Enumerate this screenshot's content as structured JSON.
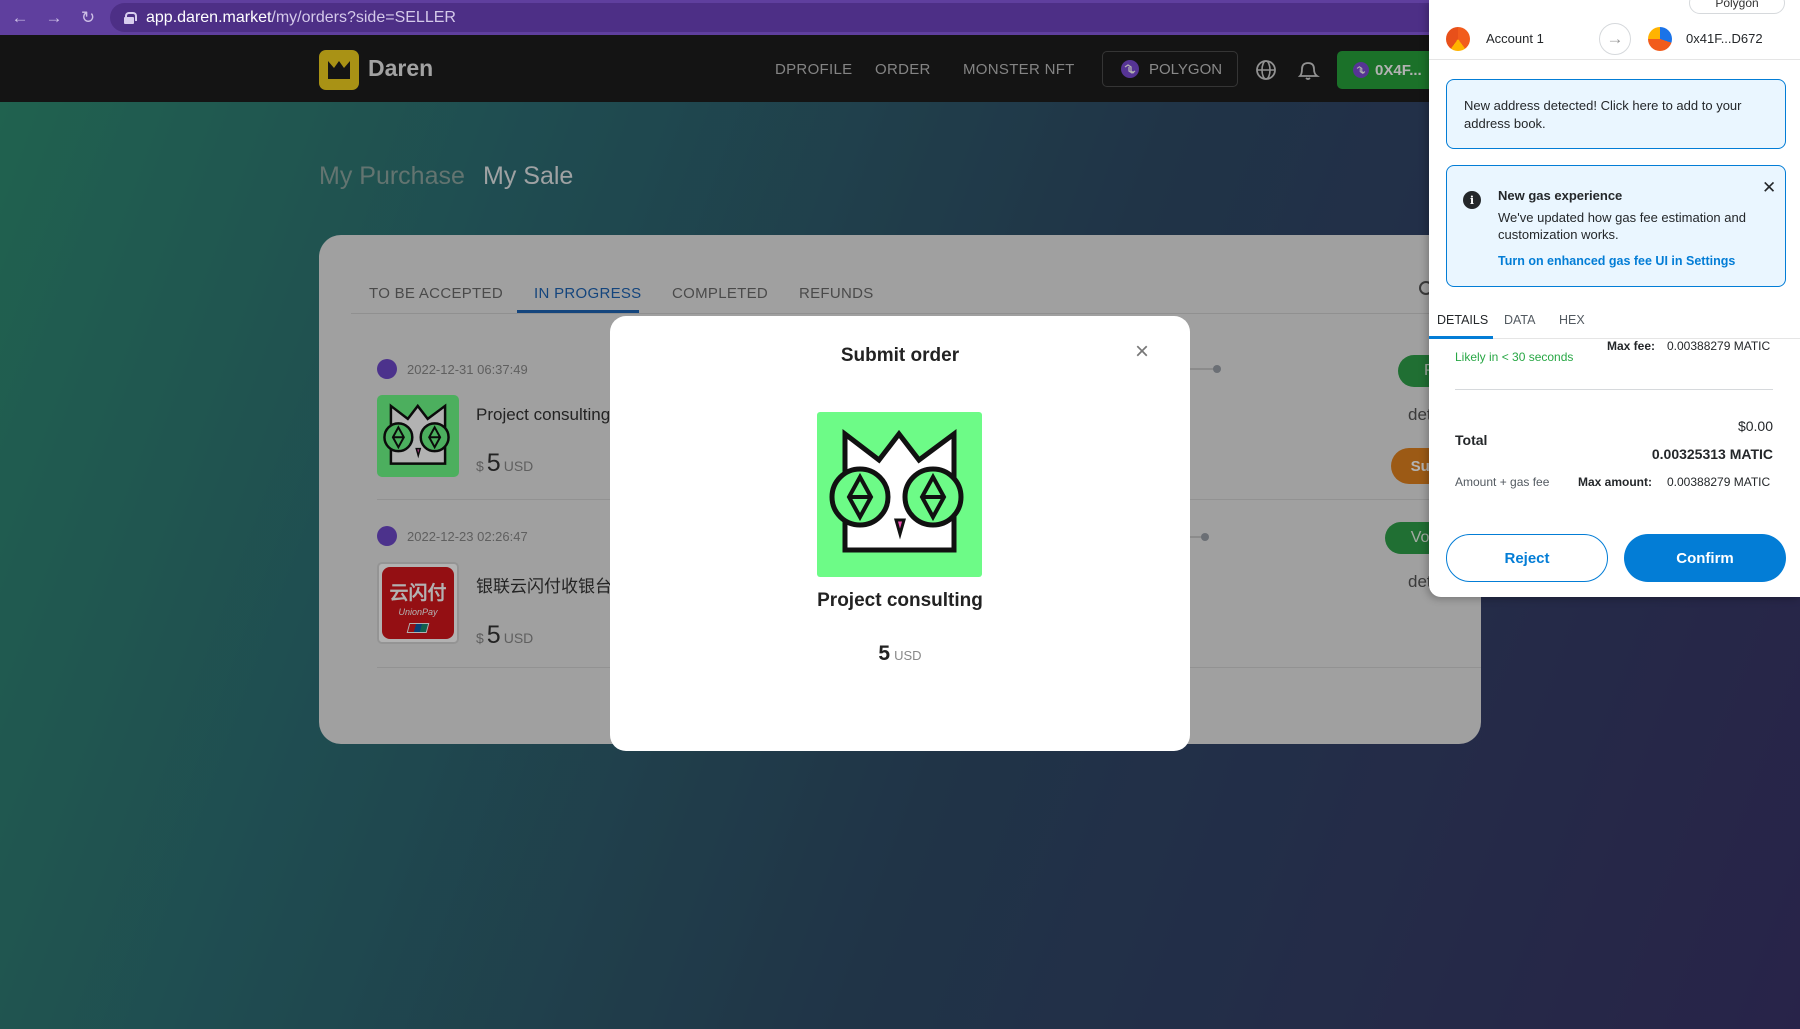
{
  "browser": {
    "url_host": "app.daren.market",
    "url_path": "/my/orders?side=SELLER"
  },
  "header": {
    "brand": "Daren",
    "nav": [
      "DPROFILE",
      "ORDER",
      "MONSTER NFT"
    ],
    "network": "POLYGON",
    "wallet_short": "0X4F..."
  },
  "page": {
    "tab_purchase": "My Purchase",
    "tab_sale": "My Sale",
    "subtabs": [
      "TO BE ACCEPTED",
      "IN PROGRESS",
      "COMPLETED",
      "REFUNDS"
    ],
    "orders": [
      {
        "date": "2022-12-31 06:37:49",
        "title": "Project consulting",
        "currency_symbol": "$",
        "amount": "5",
        "unit": "USD",
        "status": "Paid",
        "details": "details",
        "action": "Submit"
      },
      {
        "date": "2022-12-23 02:26:47",
        "title": "银联云闪付收银台",
        "currency_symbol": "$",
        "amount": "5",
        "unit": "USD",
        "status": "Voting",
        "details": "details",
        "logo_text": "云闪付",
        "logo_sub": "UnionPay"
      }
    ]
  },
  "modal": {
    "title": "Submit order",
    "product": "Project consulting",
    "amount": "5",
    "unit": "USD"
  },
  "metamask": {
    "network": "Polygon",
    "account_name": "Account 1",
    "to_address": "0x41F...D672",
    "new_address_notice": "New address detected! Click here to add to your address book.",
    "gas_title": "New gas experience",
    "gas_body": "We've updated how gas fee estimation and customization works.",
    "gas_link": "Turn on enhanced gas fee UI in Settings",
    "tabs": [
      "DETAILS",
      "DATA",
      "HEX"
    ],
    "likely": "Likely in < 30 seconds",
    "max_fee_label": "Max fee:",
    "max_fee_value": "0.00388279 MATIC",
    "total_label": "Total",
    "total_usd": "$0.00",
    "total_matic": "0.00325313 MATIC",
    "amount_gas_label": "Amount + gas fee",
    "max_amount_label": "Max amount:",
    "max_amount_value": "0.00388279 MATIC",
    "reject": "Reject",
    "confirm": "Confirm"
  },
  "colors": {
    "accent_blue": "#037dd6",
    "status_green": "#2ea04a",
    "submit_orange": "#e0821f",
    "nft_bg": "#6dfb87"
  }
}
